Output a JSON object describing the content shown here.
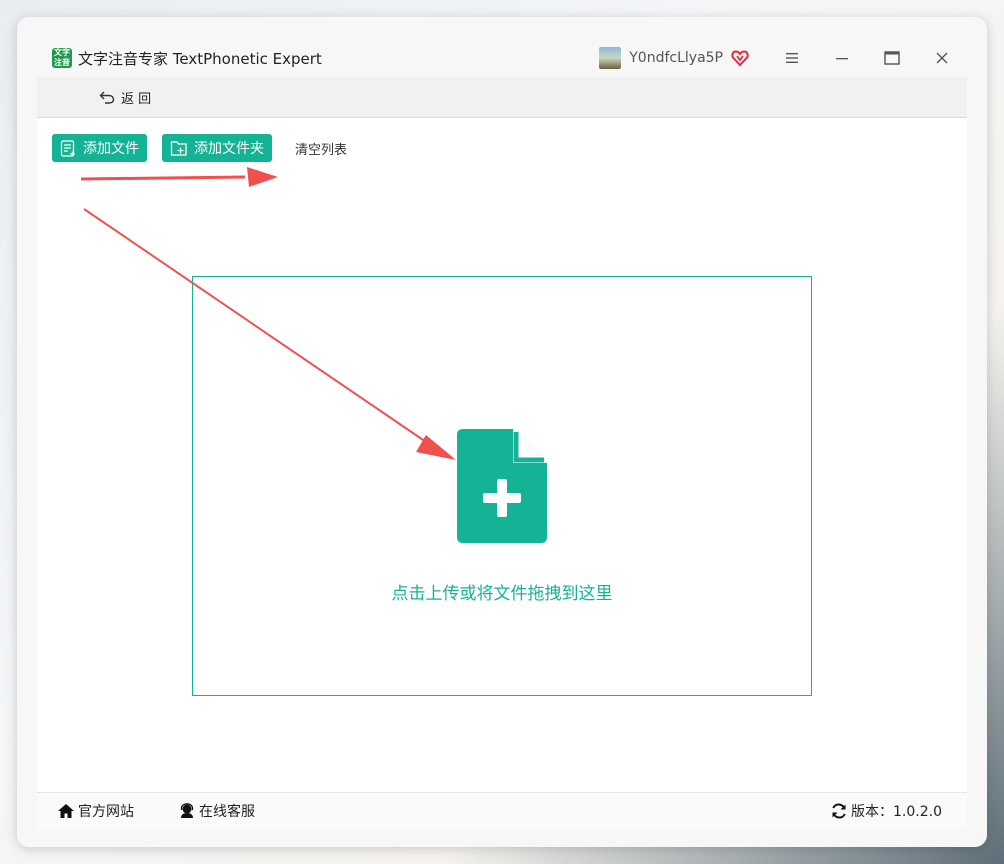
{
  "window": {
    "app_logo_text": "文字\n注音",
    "title": "文字注音专家 TextPhonetic Expert",
    "username": "Y0ndfcLlya5P",
    "icons": [
      "vip-heart-icon",
      "menu-icon",
      "minimize-icon",
      "maximize-icon",
      "close-icon"
    ]
  },
  "toolbar": {
    "back_label": "返 回"
  },
  "actions": {
    "add_file_label": "添加文件",
    "add_folder_label": "添加文件夹",
    "clear_list_label": "清空列表"
  },
  "dropzone": {
    "hint": "点击上传或将文件拖拽到这里"
  },
  "status": {
    "website_label": "官方网站",
    "support_label": "在线客服",
    "version_label": "版本：1.0.2.0"
  },
  "colors": {
    "accent": "#14b395",
    "annotation_arrow": "#f05050"
  }
}
